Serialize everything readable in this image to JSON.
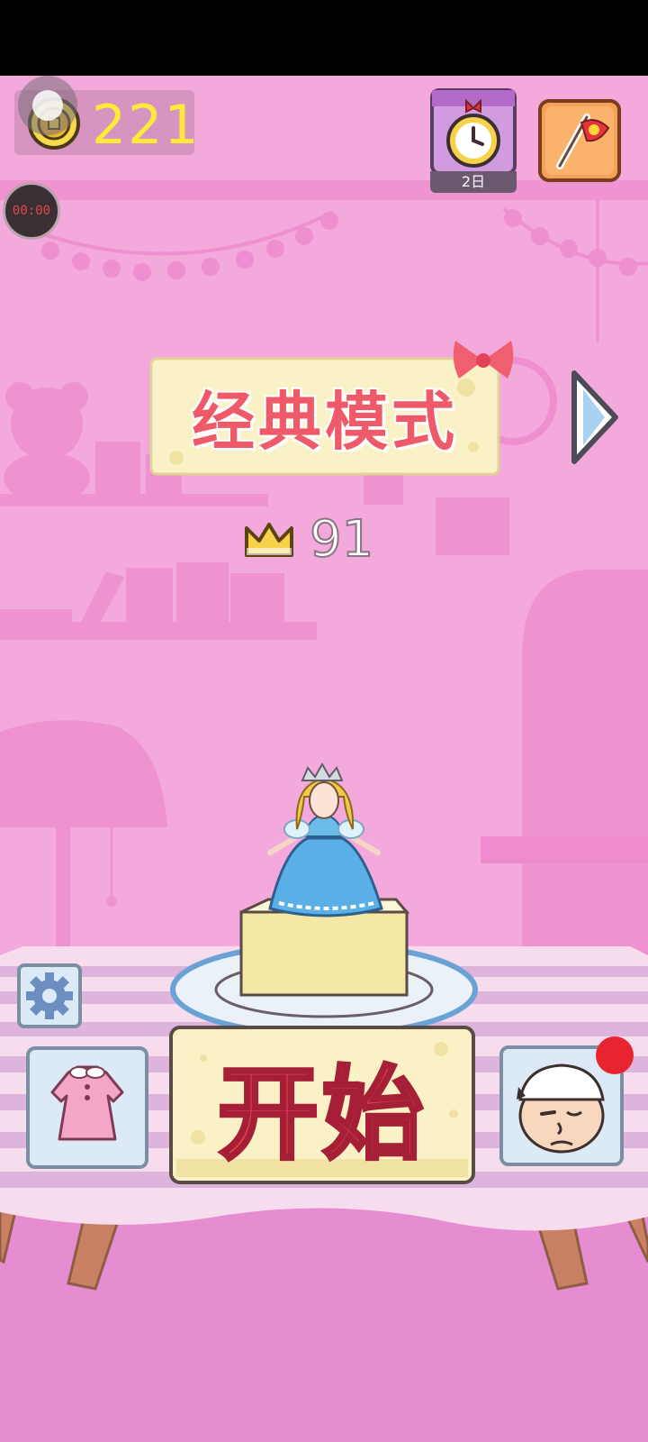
{
  "currency": {
    "coins": "221",
    "icon": "coin-icon"
  },
  "timer": {
    "display": "00:00"
  },
  "daily": {
    "label": "2日",
    "icon": "alarm-clock-icon"
  },
  "top_right": {
    "icon": "flag-icon"
  },
  "mode": {
    "title": "经典模式",
    "next_icon": "chevron-right-icon"
  },
  "best": {
    "score": "91",
    "icon": "crown-icon"
  },
  "start": {
    "label": "开始"
  },
  "menu": {
    "settings_icon": "gear-icon",
    "wardrobe_icon": "dress-icon",
    "chef_icon": "chef-face-icon",
    "chef_badge_color": "#e8242f"
  },
  "colors": {
    "background": "#f4a9dc",
    "title_text": "#ee5a68",
    "coin_text": "#ffea3a",
    "cake_cream": "#fbf1c6",
    "ice_button": "#dce9f6"
  }
}
